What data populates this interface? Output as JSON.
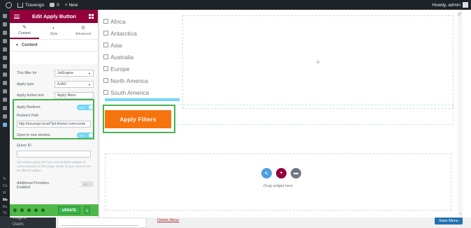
{
  "adminbar": {
    "site_name": "Travengo",
    "comments_count": "0",
    "new_label": "+ New",
    "howdy": "Howdy, admin"
  },
  "wp_sidebar": {
    "cut_labels": [
      "Tr",
      "Co",
      "W",
      "Me",
      "Ba",
      "Th"
    ],
    "plugins": "Plugins",
    "users": "Users"
  },
  "panel": {
    "title": "Edit Apply Button",
    "tabs": [
      {
        "label": "Content",
        "icon": "pencil-icon"
      },
      {
        "label": "Style",
        "icon": "half-circle-icon"
      },
      {
        "label": "Advanced",
        "icon": "gear-icon"
      }
    ],
    "section_title": "Content",
    "controls": {
      "filter_for_label": "This filter for",
      "filter_for_value": "JetEngine",
      "apply_type_label": "Apply type",
      "apply_type_value": "AJAX",
      "button_text_label": "Apply button text",
      "button_text_value": "Apply filters",
      "apply_redirect_label": "Apply Redirect",
      "apply_redirect_state": "YES",
      "redirect_path_label": "Redirect Path",
      "redirect_path_value": "http://travengo.local/?jet-theme-core=conte",
      "open_new_window_label": "Open in new window",
      "open_new_window_state": "YES",
      "query_id_label": "Query ID",
      "query_id_value": "",
      "query_id_desc": "Set unique query ID if you use multiple widgets of same provider on the page. Same ID you need to set for filtered widget.",
      "additional_providers_label": "Additional Providers Enabled",
      "additional_providers_state": "NO"
    },
    "footer": {
      "update_label": "UPDATE",
      "icons": [
        "settings-icon",
        "layers-icon",
        "history-icon",
        "responsive-icon",
        "eye-icon"
      ]
    }
  },
  "preview": {
    "checklist": [
      "Africa",
      "Antarctica",
      "Asia",
      "Australia",
      "Europe",
      "North America",
      "South America"
    ],
    "apply_button": "Apply Filters",
    "plus": "+",
    "drag_text": "Drag widget here",
    "dropzone_icons": [
      "+",
      "+",
      "■"
    ]
  },
  "wp_page": {
    "delete_menu": "Delete Menu",
    "save_menu": "Save Menu"
  },
  "colors": {
    "panel_header": "#93003c",
    "apply_button": "#f6740d",
    "highlight": "#46b450",
    "update": "#39b54a",
    "toggle_on": "#71d7f7"
  }
}
